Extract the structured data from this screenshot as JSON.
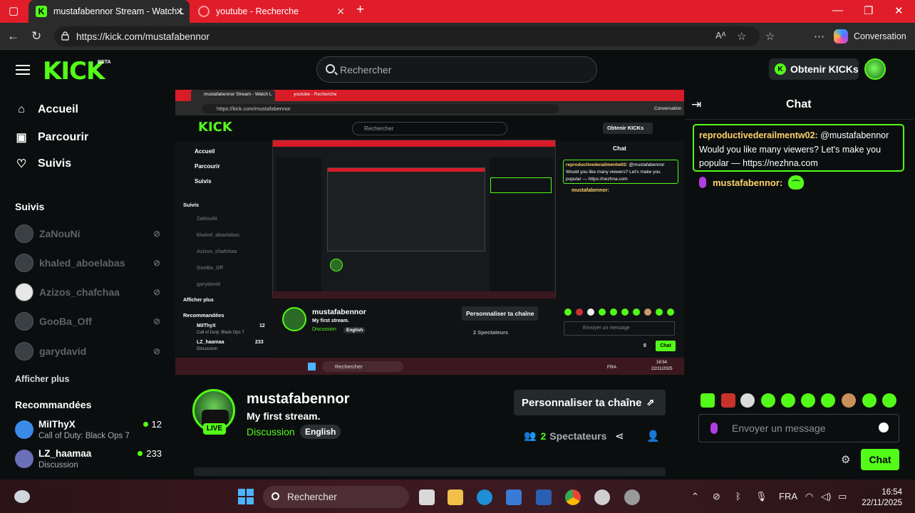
{
  "browser": {
    "tabs": [
      {
        "label": "mustafabennor Stream - Watch L",
        "active": true
      },
      {
        "label": "youtube - Recherche",
        "active": false
      }
    ],
    "url": "https://kick.com/mustafabennor",
    "conversation_label": "Conversation"
  },
  "header": {
    "logo": "KICK",
    "logo_badge": "BETA",
    "search_placeholder": "Rechercher",
    "kicks_button": "Obtenir KICKs"
  },
  "sidebar": {
    "nav": [
      {
        "label": "Accueil",
        "icon": "home-icon"
      },
      {
        "label": "Parcourir",
        "icon": "browse-icon"
      },
      {
        "label": "Suivis",
        "icon": "heart-icon"
      }
    ],
    "following_title": "Suivis",
    "following": [
      {
        "name": "ZaNouNi"
      },
      {
        "name": "khaled_aboelabas"
      },
      {
        "name": "Azizos_chafchaa"
      },
      {
        "name": "GooBa_Off"
      },
      {
        "name": "garydavid"
      }
    ],
    "show_more": "Afficher plus",
    "recommended_title": "Recommandées",
    "recommended": [
      {
        "name": "MiIThyX",
        "category": "Call of Duty: Black Ops 7",
        "viewers": "12"
      },
      {
        "name": "LZ_haamaa",
        "category": "Discussion",
        "viewers": "233"
      }
    ]
  },
  "stream": {
    "streamer": "mustafabennor",
    "title": "My first stream.",
    "category": "Discussion",
    "language": "English",
    "live_badge": "LIVE",
    "customize_button": "Personnaliser ta chaîne",
    "viewers_count": "2",
    "viewers_label": "Spectateurs"
  },
  "video_mirror": {
    "tab1": "mustafabennor Stream - Watch L",
    "tab2": "youtube - Recherche",
    "url": "https://kick.com/mustafabennor",
    "search": "Rechercher",
    "kicks": "Obtenir KICKs",
    "nav": [
      "Accueil",
      "Parcourir",
      "Suivis"
    ],
    "following_title": "Suivis",
    "following": [
      "ZaNouNi",
      "khaled_aboelabas",
      "Azizos_chafchaa",
      "GooBa_Off",
      "garydavid"
    ],
    "show_more": "Afficher plus",
    "recommended_title": "Recommandées",
    "recommended": [
      {
        "name": "MiIThyX",
        "category": "Call of Duty: Black Ops 7",
        "viewers": "12"
      },
      {
        "name": "LZ_haamaa",
        "category": "Discussion",
        "viewers": "233"
      }
    ],
    "chat_title": "Chat",
    "chat_user": "reproductivederailmentw02:",
    "chat_text": "@mustafabennor Would you like many viewers? Let's make you popular — https://nezhna.com",
    "chat_user2": "mustafabennor:",
    "streamer": "mustafabennor",
    "title": "My first stream.",
    "category": "Discussion",
    "language": "English",
    "customize": "Personnaliser ta chaîne",
    "viewers": "2 Spectateurs",
    "input": "Envoyer un message",
    "send": "Chat",
    "count": "0",
    "taskbar_search": "Rechercher",
    "lang": "FRA",
    "time": "16:54",
    "date": "22/11/2025",
    "conversation": "Conversation"
  },
  "chat": {
    "title": "Chat",
    "messages": [
      {
        "user": "reproductivederailmentw02:",
        "text": "@mustafabennor Would you like many viewers? Let's make you popular — https://nezhna.com"
      },
      {
        "user": "mustafabennor:",
        "text": ""
      }
    ],
    "input_placeholder": "Envoyer un message",
    "send_button": "Chat"
  },
  "taskbar": {
    "search_placeholder": "Rechercher",
    "language": "FRA",
    "time": "16:54",
    "date": "22/11/2025"
  }
}
